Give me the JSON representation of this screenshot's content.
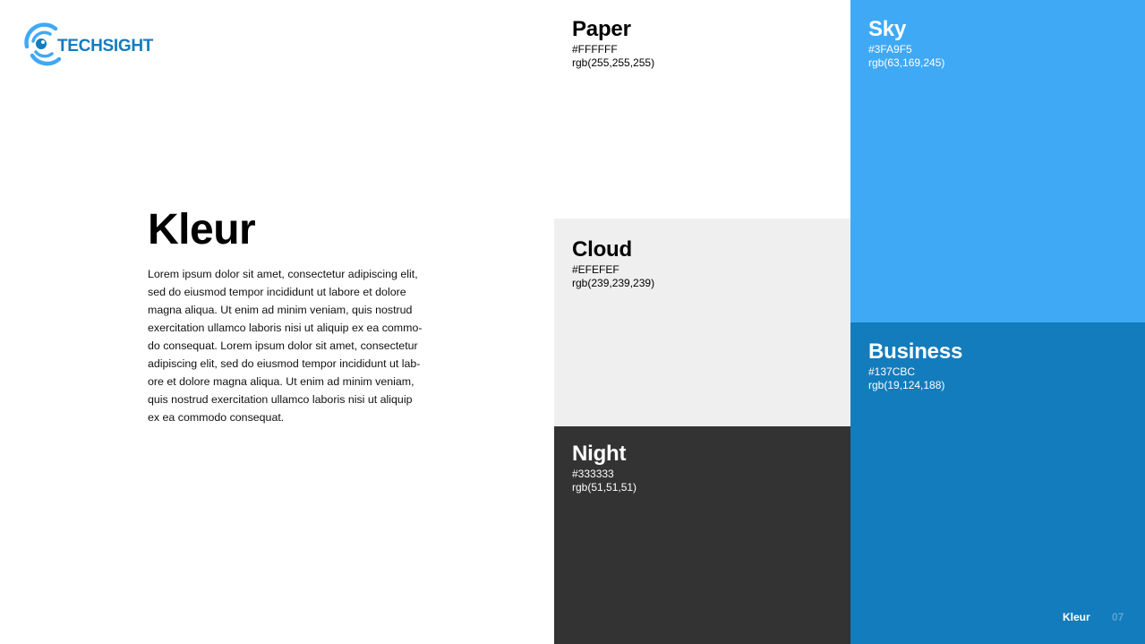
{
  "logo": {
    "text": "TECHSIGHT",
    "color": "#137CBC",
    "accent_color": "#3FA9F5",
    "icon": "eye-target-icon"
  },
  "intro": {
    "title": "Kleur",
    "body": "Lorem ipsum dolor sit amet, consectetur adipiscing elit, sed do eiusmod tempor incididunt ut labore et dolore magna aliqua. Ut enim ad minim veniam, quis nostrud exercitation ullamco laboris nisi ut aliquip ex ea commo-do consequat. Lorem ipsum dolor sit amet, consectetur adipiscing elit, sed do eiusmod tempor incididunt ut lab-ore et dolore magna aliqua. Ut enim ad minim veniam, quis nostrud exercitation ullamco laboris nisi ut aliquip ex ea commodo consequat."
  },
  "swatches": {
    "paper": {
      "name": "Paper",
      "hex": "#FFFFFF",
      "rgb": "rgb(255,255,255)"
    },
    "cloud": {
      "name": "Cloud",
      "hex": "#EFEFEF",
      "rgb": "rgb(239,239,239)"
    },
    "night": {
      "name": "Night",
      "hex": "#333333",
      "rgb": "rgb(51,51,51)"
    },
    "sky": {
      "name": "Sky",
      "hex": "#3FA9F5",
      "rgb": "rgb(63,169,245)"
    },
    "business": {
      "name": "Business",
      "hex": "#137CBC",
      "rgb": "rgb(19,124,188)"
    }
  },
  "footer": {
    "label": "Kleur",
    "page": "07"
  }
}
